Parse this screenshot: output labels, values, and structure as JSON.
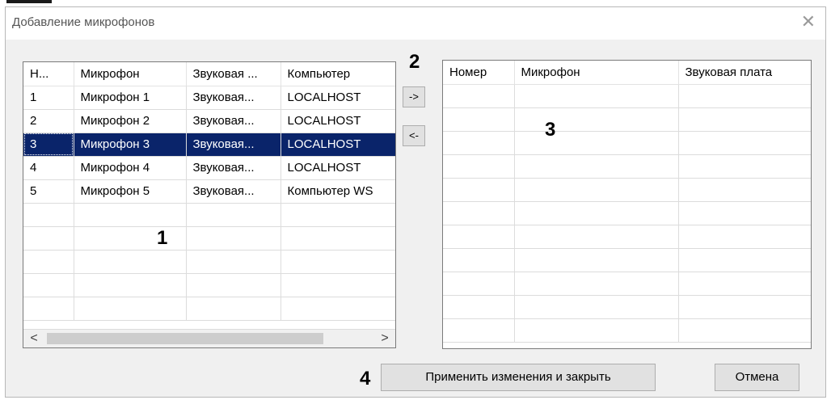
{
  "dialog": {
    "title": "Добавление микрофонов",
    "close_glyph": "✕"
  },
  "left_table": {
    "headers": [
      "Н...",
      "Микрофон",
      "Звуковая ...",
      "Компьютер"
    ],
    "rows": [
      [
        "1",
        "Микрофон 1",
        "Звуковая...",
        "LOCALHOST"
      ],
      [
        "2",
        "Микрофон 2",
        "Звуковая...",
        "LOCALHOST"
      ],
      [
        "3",
        "Микрофон 3",
        "Звуковая...",
        "LOCALHOST"
      ],
      [
        "4",
        "Микрофон 4",
        "Звуковая...",
        "LOCALHOST"
      ],
      [
        "5",
        "Микрофон 5",
        "Звуковая...",
        "Компьютер WS"
      ]
    ],
    "selected_row": 3,
    "scroll_left_glyph": "<",
    "scroll_right_glyph": ">"
  },
  "right_table": {
    "headers": [
      "Номер",
      "Микрофон",
      "Звуковая плата"
    ]
  },
  "buttons": {
    "add": "->",
    "remove": "<-",
    "apply": "Применить изменения и закрыть",
    "cancel": "Отмена"
  },
  "annotations": {
    "one": "1",
    "two": "2",
    "three": "3",
    "four": "4"
  },
  "colors": {
    "selection_bg": "#0a246a",
    "selection_text": "#ffffff"
  }
}
